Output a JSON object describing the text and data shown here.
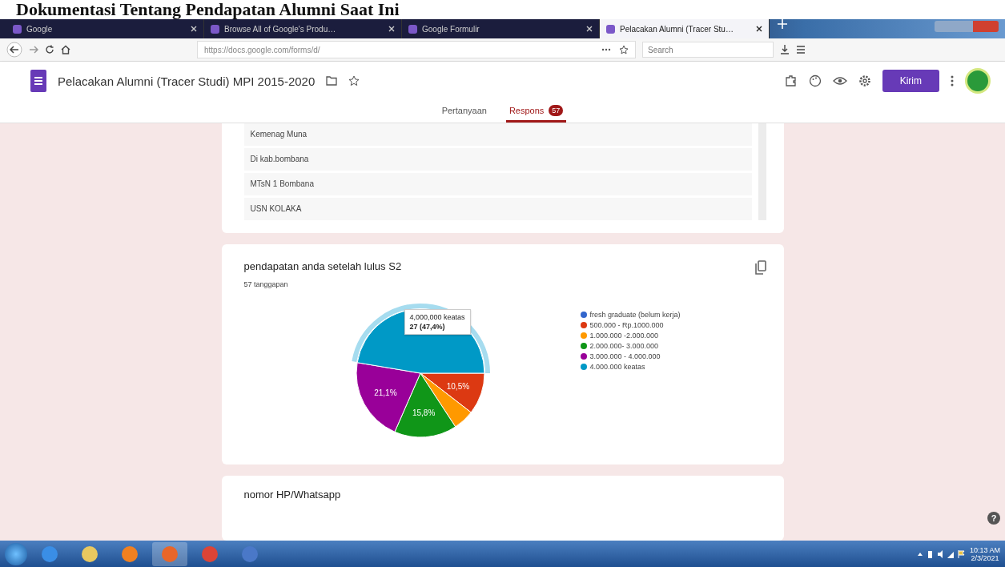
{
  "document_heading": "Dokumentasi Tentang Pendapatan Alumni Saat Ini",
  "browser": {
    "tabs": [
      {
        "title": "Google",
        "selected": false
      },
      {
        "title": "Browse All of Google's Produ…",
        "selected": false
      },
      {
        "title": "Google Formulir",
        "selected": false
      },
      {
        "title": "Pelacakan Alumni (Tracer Stu…",
        "selected": true
      }
    ],
    "url": "https://docs.google.com/forms/d/",
    "search_placeholder": "Search"
  },
  "form": {
    "title": "Pelacakan Alumni (Tracer Studi) MPI 2015-2020",
    "send_button": "Kirim",
    "tabs": [
      {
        "label": "Pertanyaan",
        "selected": false
      },
      {
        "label": "Respons",
        "selected": true,
        "badge": "57"
      }
    ]
  },
  "answer_list": [
    "Kemenag Muna",
    "Di kab.bombana",
    "MTsN 1 Bombana",
    "USN KOLAKA"
  ],
  "question": {
    "title": "pendapatan anda setelah lulus S2",
    "count": "57 tanggapan",
    "chart_data": {
      "type": "pie",
      "categories": [
        "fresh graduate (belum kerja)",
        "500.000 - Rp.1000.000",
        "1.000.000 -2.000.000",
        "2.000.000- 3.000.000",
        "3.000.000 - 4.000.000",
        "4.000.000 keatas"
      ],
      "values": [
        0,
        10.5,
        5.3,
        15.8,
        21.1,
        47.4
      ],
      "colors": [
        "#3366cc",
        "#dc3912",
        "#ff9900",
        "#109618",
        "#990099",
        "#0099c6"
      ],
      "value_labels": [
        null,
        "10,5%",
        null,
        "15,8%",
        "21,1%",
        null
      ]
    },
    "tooltip": {
      "label": "4,000,000 keatas",
      "value": "27 (47,4%)"
    }
  },
  "next_question": {
    "title": "nomor HP/Whatsapp"
  },
  "help_icon": "?",
  "taskbar": {
    "time": "10:13 AM",
    "date": "2/3/2021"
  }
}
